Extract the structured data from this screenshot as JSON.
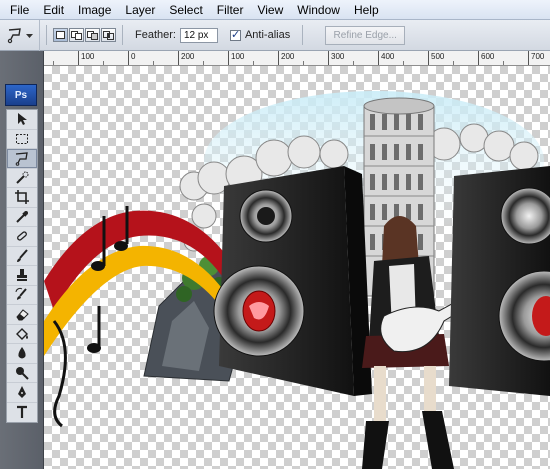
{
  "menu": {
    "items": [
      "File",
      "Edit",
      "Image",
      "Layer",
      "Select",
      "Filter",
      "View",
      "Window",
      "Help"
    ]
  },
  "options": {
    "feather_label": "Feather:",
    "feather_value": "12 px",
    "antialias_label": "Anti-alias",
    "antialias_checked": true,
    "refine_label": "Refine Edge..."
  },
  "toolbar": {
    "logo": "Ps",
    "tools": [
      "move-tool-icon",
      "marquee-tool-icon",
      "lasso-tool-icon",
      "quick-select-icon",
      "crop-tool-icon",
      "eyedropper-icon",
      "healing-brush-icon",
      "brush-tool-icon",
      "clone-stamp-icon",
      "history-brush-icon",
      "eraser-icon",
      "paint-bucket-icon",
      "blur-tool-icon",
      "dodge-tool-icon",
      "pen-tool-icon",
      "type-tool-icon"
    ],
    "active_tool": "lasso-tool-icon"
  },
  "ruler": {
    "labels": [
      "200",
      "100",
      "0",
      "100",
      "200",
      "300",
      "400",
      "500",
      "600",
      "700"
    ]
  },
  "colors": {
    "menu_bg": "#dde6f3",
    "toolbar_bg": "#5f646c",
    "speaker": "#1c1c1c",
    "ribbon_red": "#b5121b",
    "ribbon_yellow": "#f4b400"
  }
}
